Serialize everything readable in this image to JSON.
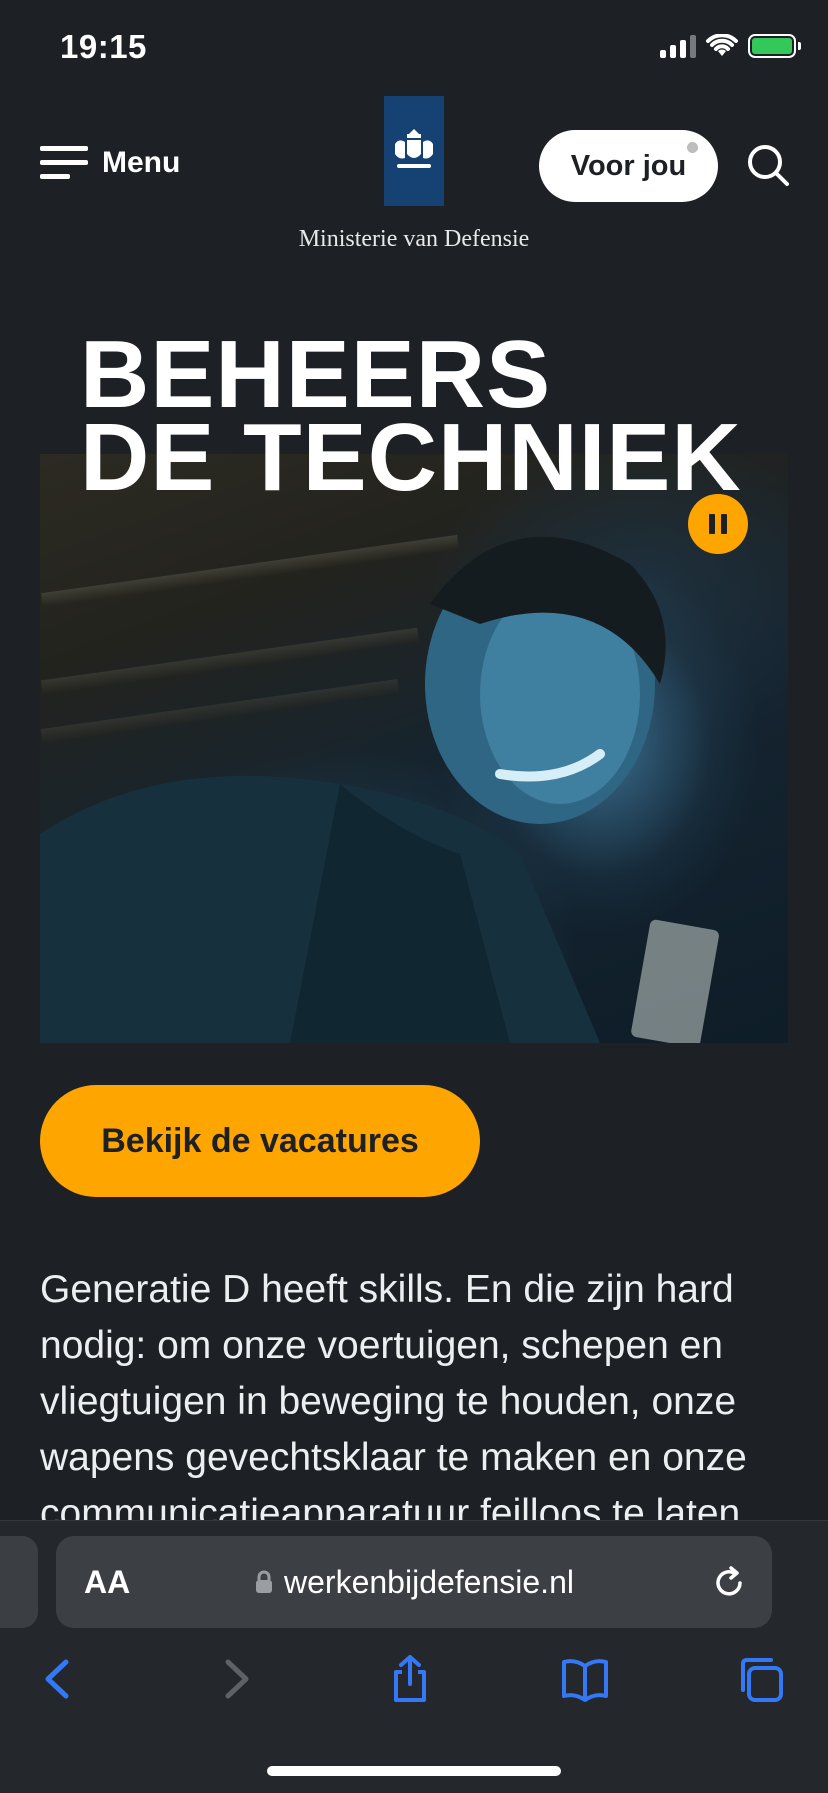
{
  "status_bar": {
    "time": "19:15"
  },
  "header": {
    "menu_label": "Menu",
    "ministry": "Ministerie van Defensie",
    "voor_jou": "Voor jou"
  },
  "hero": {
    "headline_line1": "BEHEERS",
    "headline_line2": "DE TECHNIEK"
  },
  "cta": {
    "label": "Bekijk de vacatures"
  },
  "intro": {
    "text": "Generatie D heeft skills. En die zijn hard nodig: om onze voertuigen, schepen en vliegtuigen in beweging te houden, onze wapens gevechtsklaar te maken en onze communicatieapparatuur feilloos te laten"
  },
  "browser": {
    "aa_label": "AA",
    "url": "werkenbijdefensie.nl"
  },
  "colors": {
    "background": "#1d2125",
    "accent": "#ffa500",
    "logo_blue": "#154273",
    "browser_blue": "#3478f6"
  }
}
